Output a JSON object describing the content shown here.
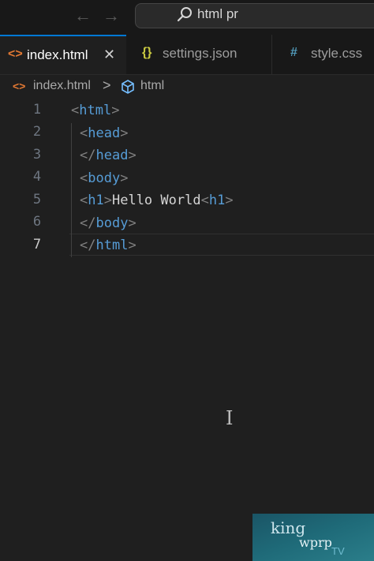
{
  "titlebar": {
    "back_icon": "arrow-left-icon",
    "forward_icon": "arrow-right-icon",
    "search": {
      "icon": "search-icon",
      "text": "html pr"
    }
  },
  "tabs": [
    {
      "icon": "html-file-icon",
      "icon_glyph": "<>",
      "icon_color": "#e37933",
      "label": "index.html",
      "active": true,
      "close_glyph": "✕"
    },
    {
      "icon": "json-file-icon",
      "icon_glyph": "{}",
      "icon_color": "#cbcb41",
      "label": "settings.json",
      "active": false
    },
    {
      "icon": "css-file-icon",
      "icon_glyph": "#",
      "icon_color": "#519aba",
      "label": "style.css",
      "active": false
    }
  ],
  "breadcrumb": {
    "file_icon_glyph": "<>",
    "file": "index.html",
    "separator": ">",
    "symbol_icon": "cube-icon",
    "symbol": "html"
  },
  "editor": {
    "current_line": 7,
    "line_numbers": [
      "1",
      "2",
      "3",
      "4",
      "5",
      "6",
      "7"
    ],
    "lines": [
      {
        "open": "<",
        "tag": "html",
        "close": ">",
        "text": "",
        "open2": "",
        "tag2": "",
        "close2": ""
      },
      {
        "open": "<",
        "tag": "head",
        "close": ">",
        "text": "",
        "open2": "",
        "tag2": "",
        "close2": ""
      },
      {
        "open": "</",
        "tag": "head",
        "close": ">",
        "text": "",
        "open2": "",
        "tag2": "",
        "close2": ""
      },
      {
        "open": "<",
        "tag": "body",
        "close": ">",
        "text": "",
        "open2": "",
        "tag2": "",
        "close2": ""
      },
      {
        "open": "<",
        "tag": "h1",
        "close": ">",
        "text": "Hello World",
        "open2": "<",
        "tag2": "h1",
        "close2": ">"
      },
      {
        "open": "</",
        "tag": "body",
        "close": ">",
        "text": "",
        "open2": "",
        "tag2": "",
        "close2": ""
      },
      {
        "open": "</",
        "tag": "html",
        "close": ">",
        "text": "",
        "open2": "",
        "tag2": "",
        "close2": ""
      }
    ],
    "cursor_glyph": "I"
  },
  "watermark": {
    "line1": "king",
    "line2": "wprp",
    "line3": "TV"
  },
  "colors": {
    "editor_bg": "#1f1f1f",
    "chrome_bg": "#181818",
    "accent": "#0078d4",
    "tag": "#569cd6",
    "punctuation": "#808080",
    "text": "#d4d4d4"
  }
}
